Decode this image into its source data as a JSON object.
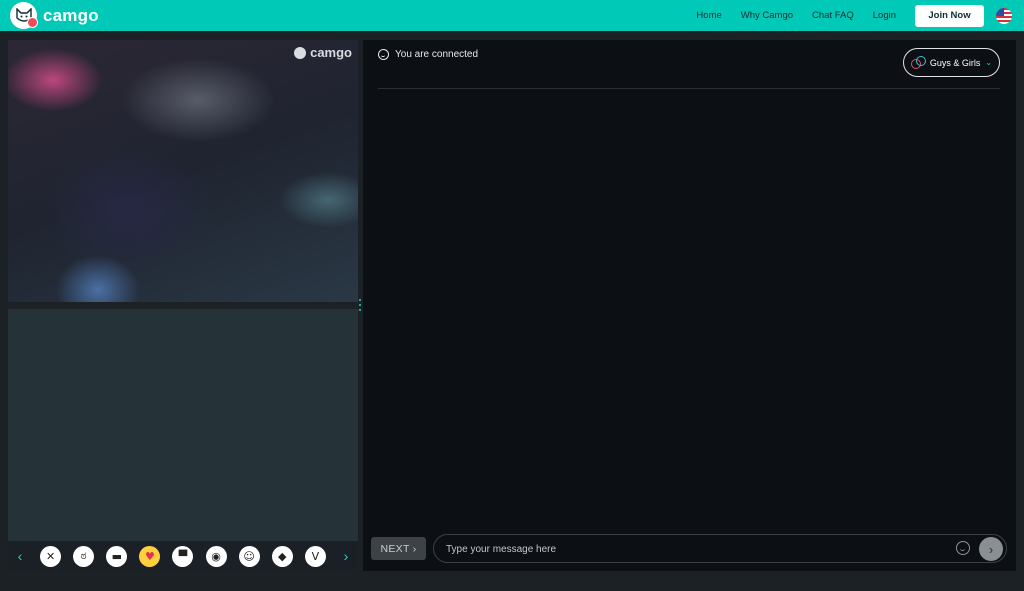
{
  "brand": {
    "name": "camgo",
    "watermark": "camgo"
  },
  "nav": {
    "links": [
      "Home",
      "Why Camgo",
      "Chat FAQ",
      "Login"
    ],
    "join_label": "Join Now",
    "language": "us-flag-icon"
  },
  "chat": {
    "status": "You are connected",
    "filter_label": "Guys & Girls",
    "next_label": "NEXT ›",
    "input_placeholder": "Type your message here",
    "send_icon": "send-arrow-icon",
    "emoji_icon": "emoji-icon"
  },
  "masks": [
    "none-mask-icon",
    "anonymous-mask-icon",
    "eye-mask-icon",
    "love-emoji-mask-icon",
    "sunglasses-mask-icon",
    "hood-mask-icon",
    "bald-mask-icon",
    "cat-mask-icon",
    "bunny-mask-icon"
  ],
  "colors": {
    "accent": "#00c9b8",
    "chat_bg": "#0c0f13",
    "page_bg": "#1c2126"
  }
}
